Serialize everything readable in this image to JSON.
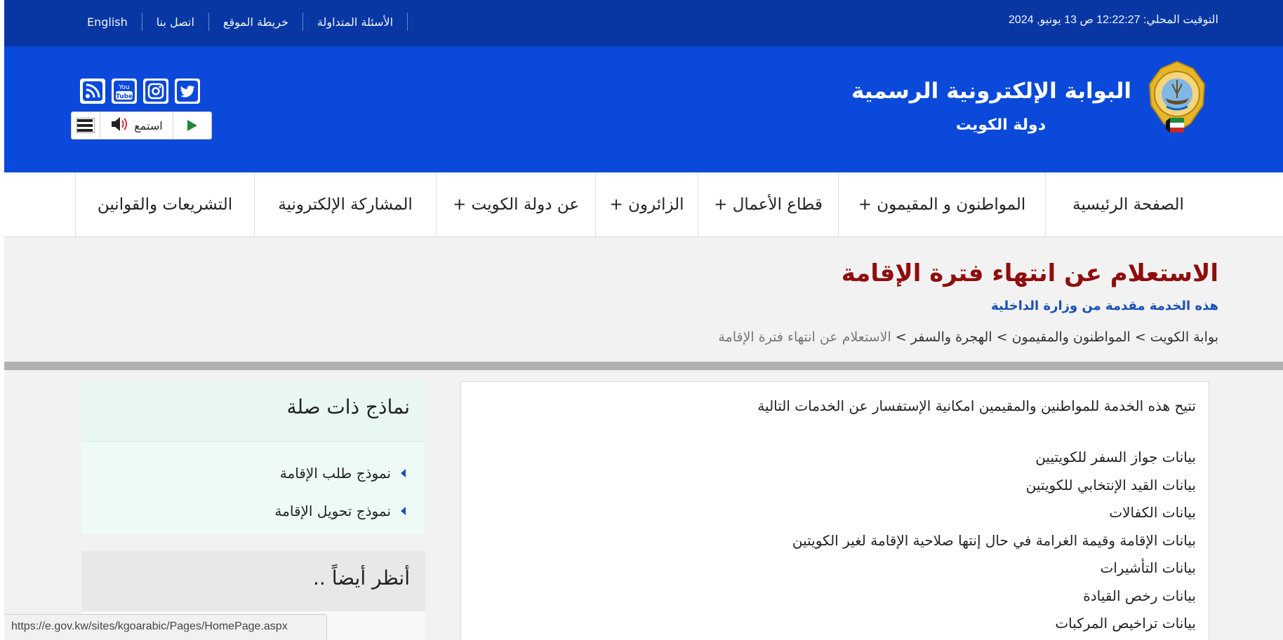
{
  "topbar": {
    "clock": "التوقيت المحلي: 12:22:27 ص 13 يونيو, 2024",
    "links": {
      "english": "English",
      "contact": "اتصل بنا",
      "sitemap": "خريطة الموقع",
      "faq": "الأسئلة المتداولة"
    }
  },
  "header": {
    "title": "البوابة الإلكترونية الرسمية",
    "subtitle": "دولة الكويت",
    "social_icons": [
      "rss-icon",
      "youtube-icon",
      "instagram-icon",
      "twitter-icon"
    ],
    "listen_label": "استمع",
    "colors": {
      "topbar": "#0837a3",
      "header": "#0a49d9"
    }
  },
  "nav": {
    "items": [
      "الصفحة الرئيسية",
      "المواطنون و المقيمون +",
      "قطاع الأعمال +",
      "الزائرون +",
      "عن دولة الكويت +",
      "المشاركة الإلكترونية",
      "التشريعات والقوانين"
    ]
  },
  "page": {
    "title": "الاستعلام عن انتهاء فترة الإقامة",
    "provider": "هذه الخدمة مقدمة من وزارة الداخلية",
    "breadcrumb": {
      "b1": "بوابة الكويت",
      "sep": ">",
      "b2": "المواطنون والمقيمون",
      "b3": "الهجرة والسفر",
      "current": "الاستعلام عن انتهاء فترة الإقامة"
    },
    "title_color": "#8f0d0d"
  },
  "content": {
    "intro": "تتيح هذه الخدمة للمواطنين والمقيمين امكانية الإستفسار عن الخدمات التالية",
    "lines": [
      "بيانات جواز السفر للكويتيين",
      "بيانات القيد الإنتخابي للكويتين",
      "بيانات الكفالات",
      "بيانات الإقامة وقيمة الغرامة في حال إنتها صلاحية الإقامة لغير الكويتين",
      "بيانات التأشيرات",
      "بيانات رخص القيادة",
      "بيانات تراخيص المركبات"
    ]
  },
  "sidebar": {
    "related_title": "نماذج ذات صلة",
    "related_items": [
      "نموذج طلب الإقامة",
      "نموذج تحويل الإقامة"
    ],
    "see_also_title": "أنظر أيضاً .."
  },
  "status_url": "https://e.gov.kw/sites/kgoarabic/Pages/HomePage.aspx"
}
